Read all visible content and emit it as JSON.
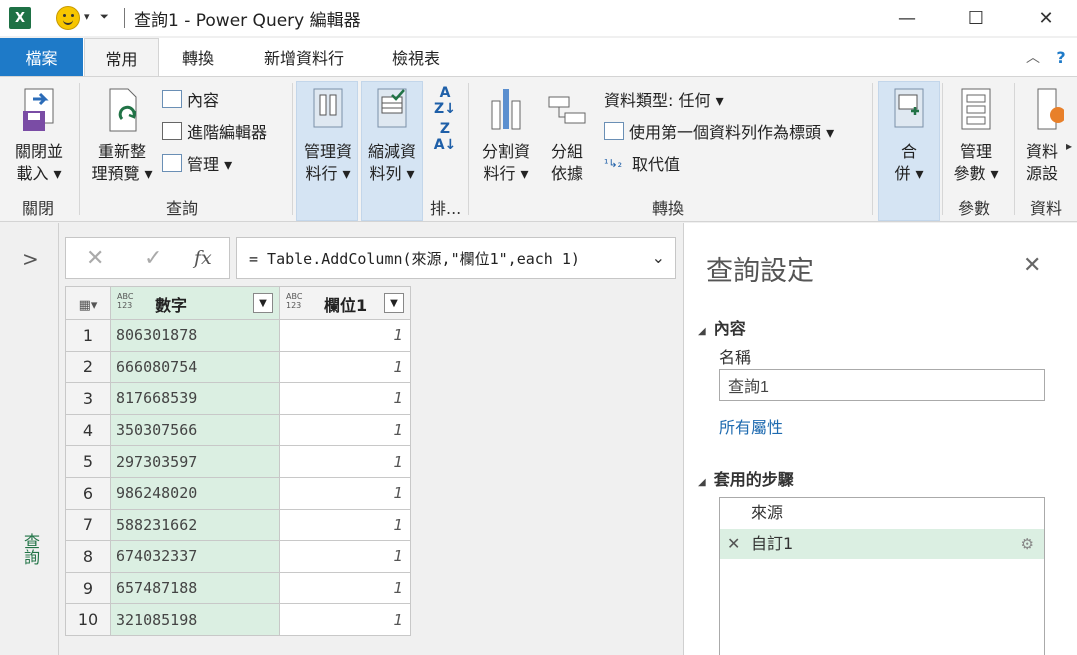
{
  "window": {
    "title": "查詢1 - Power Query 編輯器",
    "app_icon": "X",
    "minimize": "—",
    "maximize": "☐",
    "close": "✕"
  },
  "tabs": [
    "檔案",
    "常用",
    "轉換",
    "新增資料行",
    "檢視表"
  ],
  "ribbon": {
    "close_load": [
      "關閉並",
      "載入 ▾"
    ],
    "refresh": [
      "重新整",
      "理預覽 ▾"
    ],
    "properties": "內容",
    "advanced_editor": "進階編輯器",
    "manage": "管理 ▾",
    "manage_columns": [
      "管理資",
      "料行 ▾"
    ],
    "reduce_rows": [
      "縮減資",
      "料列 ▾"
    ],
    "split_column": [
      "分割資",
      "料行 ▾"
    ],
    "group_by": [
      "分組",
      "依據"
    ],
    "data_type": "資料類型: 任何 ▾",
    "use_first_row": "使用第一個資料列作為標頭 ▾",
    "replace_values": "取代值",
    "combine": [
      "合",
      "併 ▾"
    ],
    "manage_params": [
      "管理",
      "參數 ▾"
    ],
    "data_source": [
      "資料",
      "源設"
    ],
    "groups": {
      "close": "關閉",
      "query": "查詢",
      "sort": "排...",
      "transform": "轉換",
      "params": "參數",
      "data": "資料"
    }
  },
  "leftnav": {
    "label": "查詢"
  },
  "formula_bar": {
    "cancel": "✕",
    "commit": "✓",
    "fx": "fx",
    "formula": "= Table.AddColumn(來源,\"欄位1\",each 1)"
  },
  "table": {
    "columns": [
      {
        "type": "ABC\n123",
        "name": "數字"
      },
      {
        "type": "ABC\n123",
        "name": "欄位1"
      }
    ],
    "rows": [
      [
        "1",
        "806301878",
        "1"
      ],
      [
        "2",
        "666080754",
        "1"
      ],
      [
        "3",
        "817668539",
        "1"
      ],
      [
        "4",
        "350307566",
        "1"
      ],
      [
        "5",
        "297303597",
        "1"
      ],
      [
        "6",
        "986248020",
        "1"
      ],
      [
        "7",
        "588231662",
        "1"
      ],
      [
        "8",
        "674032337",
        "1"
      ],
      [
        "9",
        "657487188",
        "1"
      ],
      [
        "10",
        "321085198",
        "1"
      ]
    ]
  },
  "settings": {
    "title": "查詢設定",
    "properties_header": "內容",
    "name_label": "名稱",
    "name_value": "查詢1",
    "all_properties": "所有屬性",
    "applied_steps_header": "套用的步驟",
    "steps": [
      "來源",
      "自訂1"
    ]
  },
  "colors": {
    "file_tab": "#1e7ac8",
    "selected_green": "#dbefe2",
    "excel_green": "#217346"
  }
}
